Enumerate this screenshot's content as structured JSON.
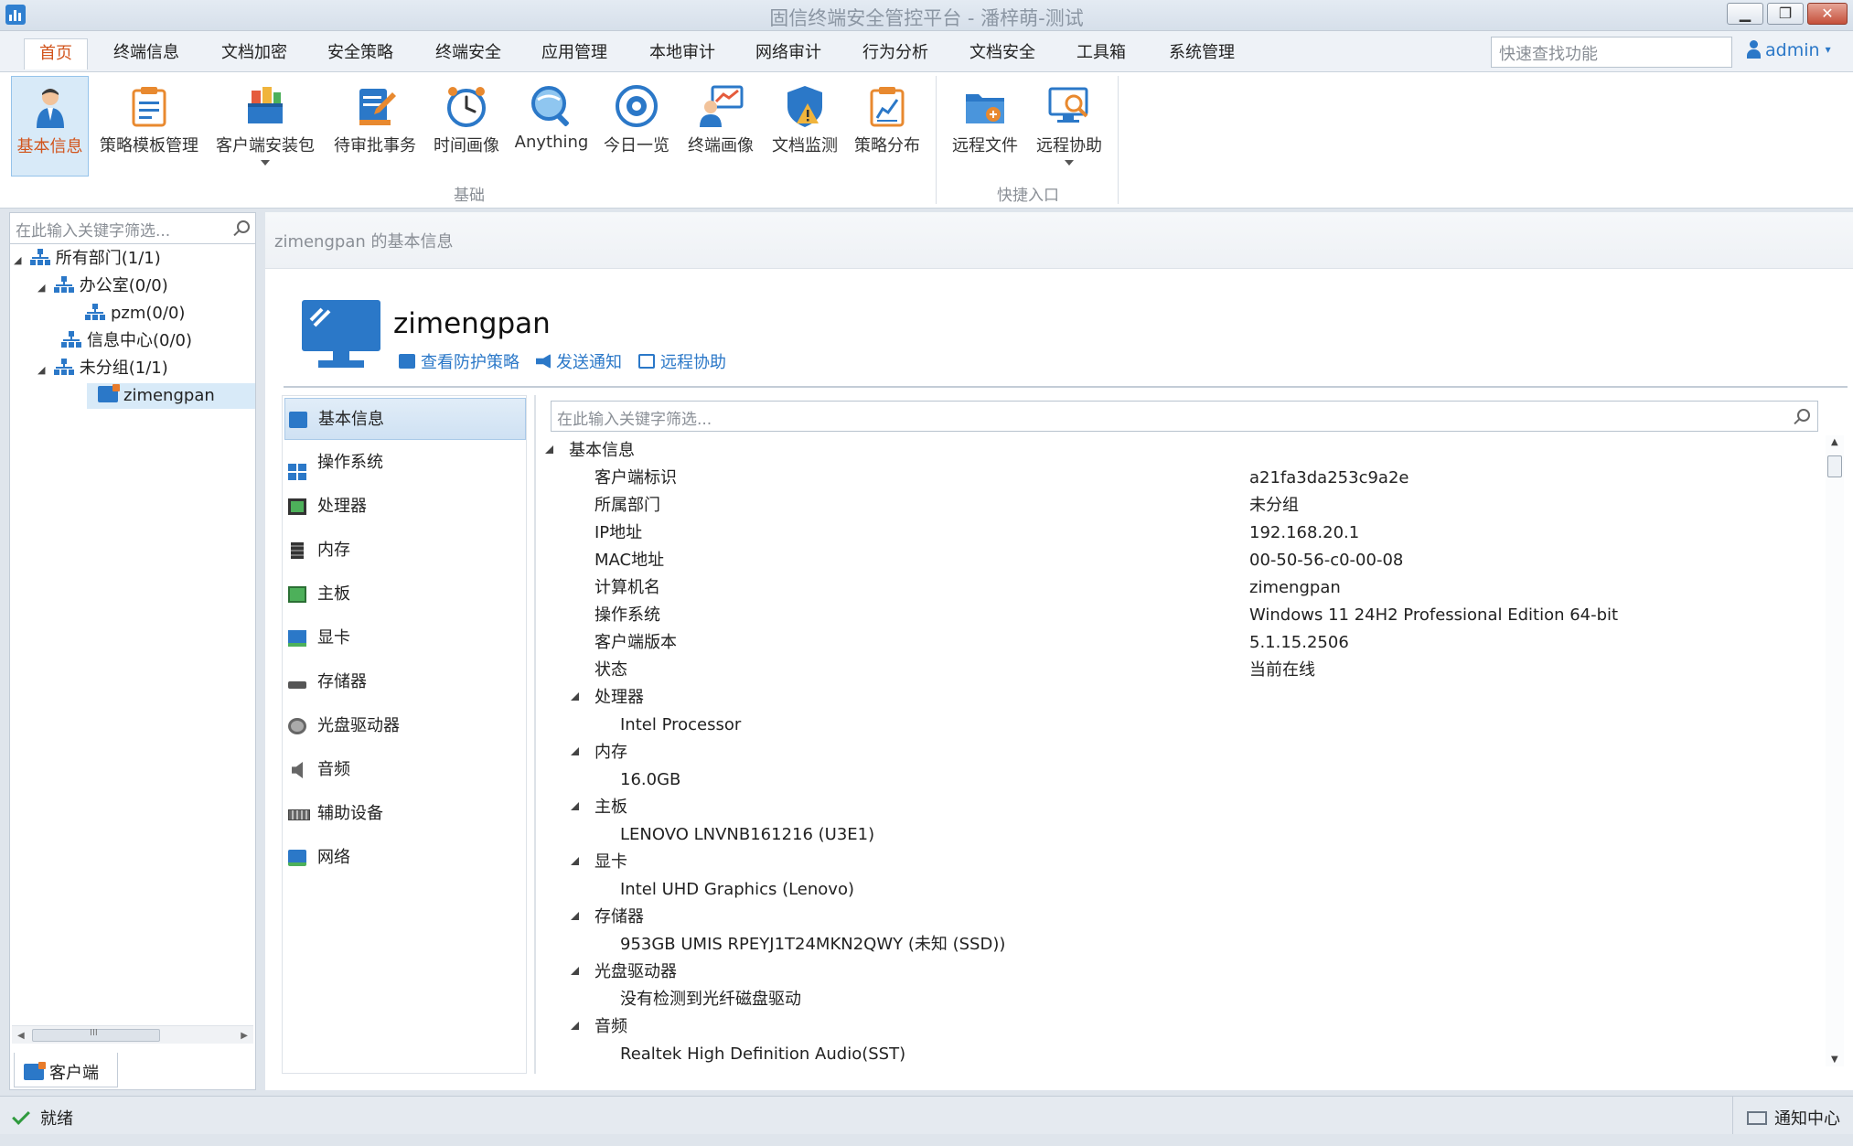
{
  "window": {
    "title": "固信终端安全管控平台 - 潘梓萌-测试",
    "controls": [
      "minimize",
      "restore",
      "close"
    ]
  },
  "menu": {
    "tabs": [
      {
        "label": "首页",
        "active": true
      },
      {
        "label": "终端信息"
      },
      {
        "label": "文档加密"
      },
      {
        "label": "安全策略"
      },
      {
        "label": "终端安全"
      },
      {
        "label": "应用管理"
      },
      {
        "label": "本地审计"
      },
      {
        "label": "网络审计"
      },
      {
        "label": "行为分析"
      },
      {
        "label": "文档安全"
      },
      {
        "label": "工具箱"
      },
      {
        "label": "系统管理"
      }
    ],
    "search_placeholder": "快速查找功能",
    "user": "admin"
  },
  "ribbon": {
    "groups": [
      {
        "label": "基础",
        "items": [
          {
            "label": "基本信息",
            "icon": "user-info-icon",
            "active": true
          },
          {
            "label": "策略模板管理",
            "icon": "template-icon"
          },
          {
            "label": "客户端安装包",
            "icon": "package-icon",
            "dropdown": true
          },
          {
            "label": "待审批事务",
            "icon": "approval-icon"
          },
          {
            "label": "时间画像",
            "icon": "clock-icon"
          },
          {
            "label": "Anything",
            "icon": "search-globe-icon"
          },
          {
            "label": "今日一览",
            "icon": "eye-icon"
          },
          {
            "label": "终端画像",
            "icon": "terminal-profile-icon"
          },
          {
            "label": "文档监测",
            "icon": "shield-alert-icon"
          },
          {
            "label": "策略分布",
            "icon": "chart-doc-icon"
          }
        ]
      },
      {
        "label": "快捷入口",
        "items": [
          {
            "label": "远程文件",
            "icon": "folder-icon"
          },
          {
            "label": "远程协助",
            "icon": "remote-assist-icon",
            "dropdown": true
          }
        ]
      }
    ]
  },
  "tree": {
    "filter_placeholder": "在此输入关键字筛选...",
    "nodes": [
      {
        "label": "所有部门(1/1)",
        "level": 0,
        "expanded": true,
        "type": "org"
      },
      {
        "label": "办公室(0/0)",
        "level": 1,
        "expanded": true,
        "type": "org"
      },
      {
        "label": "pzm(0/0)",
        "level": 2,
        "type": "org"
      },
      {
        "label": "信息中心(0/0)",
        "level": 1,
        "type": "org"
      },
      {
        "label": "未分组(1/1)",
        "level": 1,
        "expanded": true,
        "type": "org"
      },
      {
        "label": "zimengpan",
        "level": 2,
        "type": "pc",
        "selected": true
      }
    ],
    "bottom_tab": "客户端"
  },
  "content": {
    "breadcrumb": "zimengpan 的基本信息",
    "host_name": "zimengpan",
    "actions": [
      "查看防护策略",
      "发送通知",
      "远程协助"
    ]
  },
  "categories": [
    {
      "label": "基本信息",
      "icon": "monitor-icon",
      "active": true
    },
    {
      "label": "操作系统",
      "icon": "windows-icon"
    },
    {
      "label": "处理器",
      "icon": "cpu-icon"
    },
    {
      "label": "内存",
      "icon": "memory-icon"
    },
    {
      "label": "主板",
      "icon": "motherboard-icon"
    },
    {
      "label": "显卡",
      "icon": "graphics-card-icon"
    },
    {
      "label": "存储器",
      "icon": "storage-icon"
    },
    {
      "label": "光盘驱动器",
      "icon": "optical-drive-icon"
    },
    {
      "label": "音频",
      "icon": "speaker-icon"
    },
    {
      "label": "辅助设备",
      "icon": "keyboard-icon"
    },
    {
      "label": "网络",
      "icon": "network-icon"
    }
  ],
  "detail": {
    "filter_placeholder": "在此输入关键字筛选...",
    "section_title": "基本信息",
    "properties": [
      {
        "key": "客户端标识",
        "value": "a21fa3da253c9a2e"
      },
      {
        "key": "所属部门",
        "value": "未分组"
      },
      {
        "key": "IP地址",
        "value": "192.168.20.1"
      },
      {
        "key": "MAC地址",
        "value": "00-50-56-c0-00-08"
      },
      {
        "key": "计算机名",
        "value": "zimengpan"
      },
      {
        "key": "操作系统",
        "value": "Windows 11 24H2 Professional Edition 64-bit"
      },
      {
        "key": "客户端版本",
        "value": "5.1.15.2506"
      },
      {
        "key": "状态",
        "value": "当前在线"
      }
    ],
    "hardware": [
      {
        "group": "处理器",
        "value": "Intel Processor"
      },
      {
        "group": "内存",
        "value": "16.0GB"
      },
      {
        "group": "主板",
        "value": "LENOVO LNVNB161216 (U3E1)"
      },
      {
        "group": "显卡",
        "value": "Intel UHD Graphics (Lenovo)"
      },
      {
        "group": "存储器",
        "value": "953GB UMIS RPEYJ1T24MKN2QWY (未知 (SSD))"
      },
      {
        "group": "光盘驱动器",
        "value": "没有检测到光纤磁盘驱动"
      },
      {
        "group": "音频",
        "value": "Realtek High Definition Audio(SST)"
      }
    ]
  },
  "status": {
    "ready": "就绪",
    "notification_center": "通知中心"
  },
  "colors": {
    "accent": "#2b78c8",
    "active_tab_text": "#d2541c",
    "selected_bg": "#d8eaf8"
  }
}
